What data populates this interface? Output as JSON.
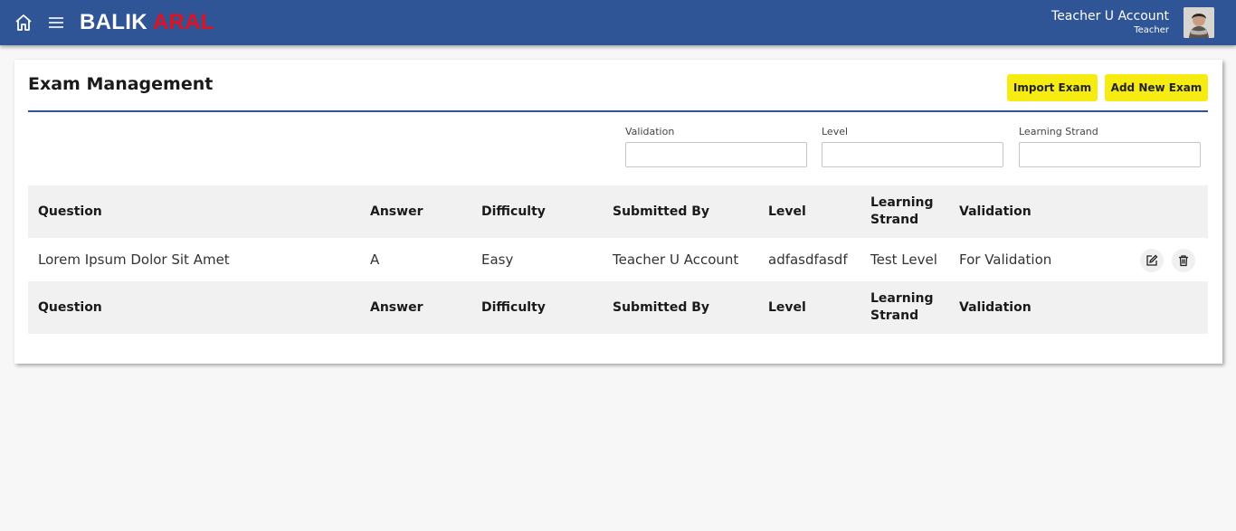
{
  "header": {
    "logo_part1": "BALIK ",
    "logo_part2": "ARAL",
    "user_name": "Teacher U Account",
    "user_role": "Teacher"
  },
  "page": {
    "title": "Exam Management",
    "import_label": "Import Exam",
    "add_label": "Add New Exam"
  },
  "filters": {
    "validation_label": "Validation",
    "validation_value": "",
    "level_label": "Level",
    "level_value": "",
    "strand_label": "Learning Strand",
    "strand_value": ""
  },
  "table": {
    "columns": [
      "Question",
      "Answer",
      "Difficulty",
      "Submitted By",
      "Level",
      "Learning Strand",
      "Validation"
    ],
    "rows": [
      [
        "Lorem Ipsum Dolor Sit Amet",
        "A",
        "Easy",
        "Teacher U Account",
        "adfasdfasdf",
        "Test Level",
        "For Validation"
      ]
    ]
  },
  "icons": {
    "home": "home-icon",
    "menu": "hamburger-menu-icon",
    "edit": "edit-icon",
    "delete": "trash-icon"
  },
  "colors": {
    "brand": "#2f5597",
    "accent": "#f7ec12",
    "logo_red": "#e3101d"
  }
}
